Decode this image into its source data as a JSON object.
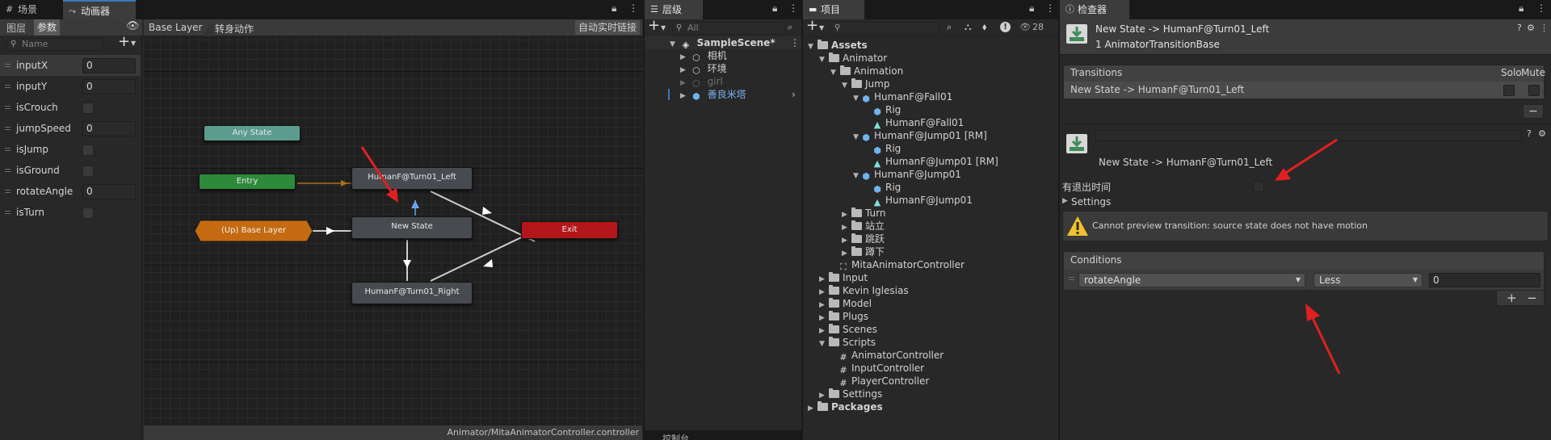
{
  "animator_panel": {
    "tabs": [
      {
        "label": "场景",
        "icon": "grid-icon"
      },
      {
        "label": "动画器",
        "icon": "animator-icon"
      }
    ],
    "sub_tabs": [
      "图层",
      "参数"
    ],
    "search_placeholder": "Name",
    "add_button": "+",
    "breadcrumb": [
      "Base Layer",
      "转身动作"
    ],
    "auto_live_link": "自动实时链接",
    "parameters": [
      {
        "name": "inputX",
        "type": "float",
        "value": "0"
      },
      {
        "name": "inputY",
        "type": "float",
        "value": "0"
      },
      {
        "name": "isCrouch",
        "type": "bool",
        "value": ""
      },
      {
        "name": "jumpSpeed",
        "type": "float",
        "value": "0"
      },
      {
        "name": "isJump",
        "type": "bool",
        "value": ""
      },
      {
        "name": "isGround",
        "type": "bool",
        "value": ""
      },
      {
        "name": "rotateAngle",
        "type": "float",
        "value": "0"
      },
      {
        "name": "isTurn",
        "type": "bool",
        "value": ""
      }
    ],
    "nodes": {
      "any_state": "Any State",
      "entry": "Entry",
      "up_base_layer": "(Up) Base Layer",
      "turn_left": "HumanF@Turn01_Left",
      "new_state": "New State",
      "turn_right": "HumanF@Turn01_Right",
      "exit": "Exit"
    },
    "footer_path": "Animator/MitaAnimatorController.controller",
    "colors": {
      "any_state": "#5a9d8e",
      "entry": "#2d8a3a",
      "base_layer": "#c46b11",
      "exit": "#b3161a",
      "selected": "#4f86c6"
    }
  },
  "hierarchy_panel": {
    "tab_label": "层级",
    "search_placeholder": "All",
    "add_button": "+",
    "items": [
      {
        "label": "SampleScene*",
        "level": 0,
        "icon": "unity-scene-icon"
      },
      {
        "label": "相机",
        "level": 1,
        "icon": "gameobject-icon"
      },
      {
        "label": "环境",
        "level": 1,
        "icon": "gameobject-icon"
      },
      {
        "label": "girl",
        "level": 1,
        "icon": "gameobject-icon"
      },
      {
        "label": "善良米塔",
        "level": 1,
        "icon": "prefab-icon"
      }
    ],
    "bottom_tab": "控制台"
  },
  "project_panel": {
    "tab_label": "项目",
    "add_button": "+",
    "hidden_count": "28",
    "tree": [
      {
        "label": "Assets",
        "level": 0,
        "kind": "folder",
        "expanded": true
      },
      {
        "label": "Animator",
        "level": 1,
        "kind": "folder",
        "expanded": true
      },
      {
        "label": "Animation",
        "level": 2,
        "kind": "folder",
        "expanded": true
      },
      {
        "label": "Jump",
        "level": 3,
        "kind": "folder",
        "expanded": true
      },
      {
        "label": "HumanF@Fall01",
        "level": 4,
        "kind": "model",
        "expanded": true
      },
      {
        "label": "Rig",
        "level": 5,
        "kind": "mesh"
      },
      {
        "label": "HumanF@Fall01",
        "level": 5,
        "kind": "anim"
      },
      {
        "label": "HumanF@Jump01 [RM]",
        "level": 4,
        "kind": "model",
        "expanded": true
      },
      {
        "label": "Rig",
        "level": 5,
        "kind": "mesh"
      },
      {
        "label": "HumanF@Jump01 [RM]",
        "level": 5,
        "kind": "anim"
      },
      {
        "label": "HumanF@Jump01",
        "level": 4,
        "kind": "model",
        "expanded": true
      },
      {
        "label": "Rig",
        "level": 5,
        "kind": "mesh"
      },
      {
        "label": "HumanF@Jump01",
        "level": 5,
        "kind": "anim"
      },
      {
        "label": "Turn",
        "level": 3,
        "kind": "folder",
        "expanded": false
      },
      {
        "label": "站立",
        "level": 3,
        "kind": "folder",
        "expanded": false
      },
      {
        "label": "跳跃",
        "level": 3,
        "kind": "folder",
        "expanded": false
      },
      {
        "label": "蹲下",
        "level": 3,
        "kind": "folder",
        "expanded": false
      },
      {
        "label": "MitaAnimatorController",
        "level": 2,
        "kind": "controller"
      },
      {
        "label": "Input",
        "level": 1,
        "kind": "folder",
        "expanded": false
      },
      {
        "label": "Kevin Iglesias",
        "level": 1,
        "kind": "folder",
        "expanded": false
      },
      {
        "label": "Model",
        "level": 1,
        "kind": "folder",
        "expanded": false
      },
      {
        "label": "Plugs",
        "level": 1,
        "kind": "folder",
        "expanded": false
      },
      {
        "label": "Scenes",
        "level": 1,
        "kind": "folder",
        "expanded": false
      },
      {
        "label": "Scripts",
        "level": 1,
        "kind": "folder",
        "expanded": true
      },
      {
        "label": "AnimatorController",
        "level": 2,
        "kind": "script"
      },
      {
        "label": "InputController",
        "level": 2,
        "kind": "script"
      },
      {
        "label": "PlayerController",
        "level": 2,
        "kind": "script"
      },
      {
        "label": "Settings",
        "level": 1,
        "kind": "folder",
        "expanded": false
      },
      {
        "label": "Packages",
        "level": 0,
        "kind": "folder",
        "expanded": false
      }
    ]
  },
  "inspector_panel": {
    "tab_label": "检查器",
    "title": "New State -> HumanF@Turn01_Left",
    "subtitle": "1 AnimatorTransitionBase",
    "transitions_header": "Transitions",
    "solo_label": "Solo",
    "mute_label": "Mute",
    "transition_row": "New State -> HumanF@Turn01_Left",
    "minus": "−",
    "transition_name_placeholder": "",
    "transition_label": "New State -> HumanF@Turn01_Left",
    "has_exit_time_label": "有退出时间",
    "settings_label": "Settings",
    "warning": "Cannot preview transition: source state does not have motion",
    "conditions_header": "Conditions",
    "condition": {
      "parameter": "rotateAngle",
      "mode": "Less",
      "value": "0"
    },
    "plus": "+"
  }
}
